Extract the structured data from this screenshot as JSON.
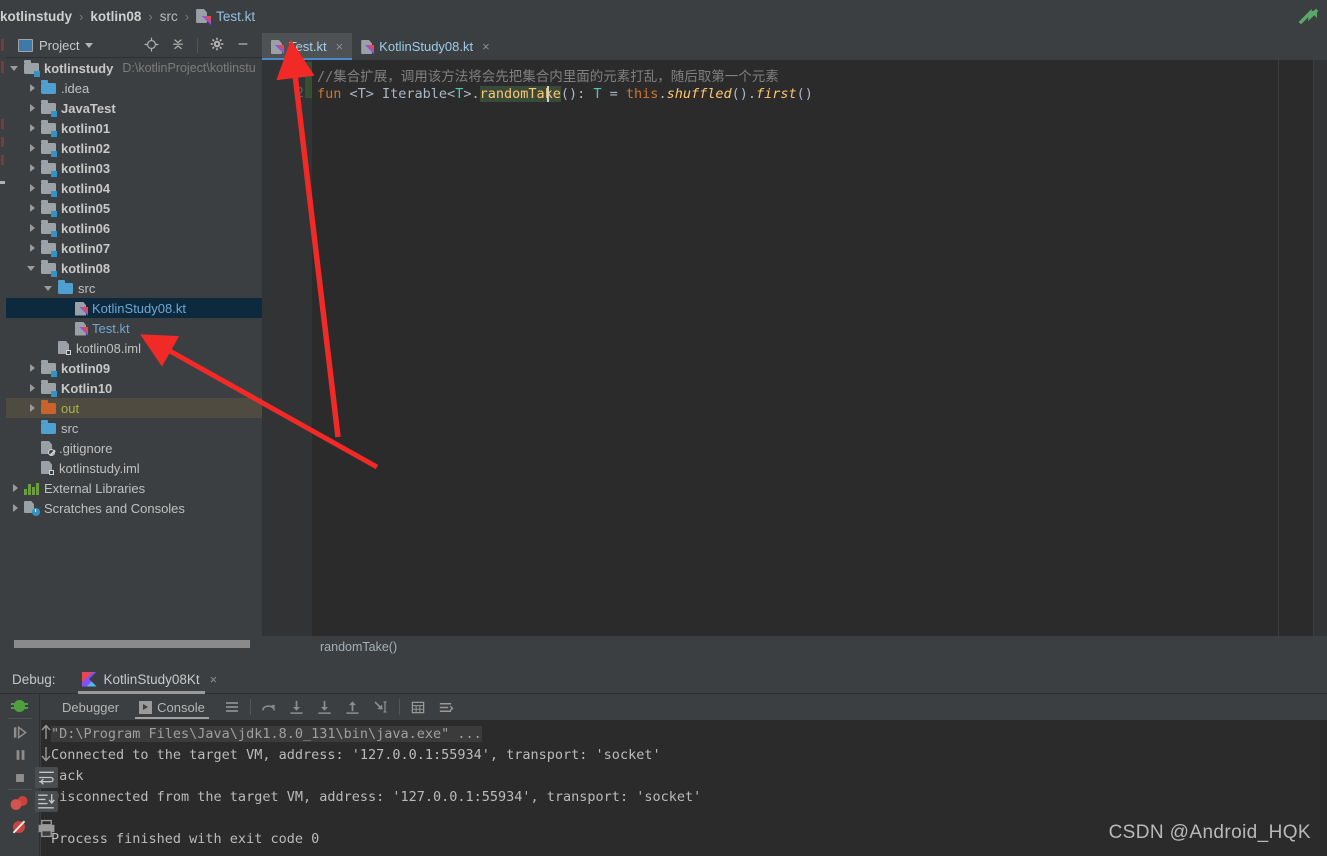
{
  "breadcrumb": {
    "items": [
      "kotlinstudy",
      "kotlin08",
      "src"
    ],
    "file": "Test.kt",
    "separator": "›"
  },
  "project_panel": {
    "title": "Project",
    "icons": [
      "locate-icon",
      "collapse-all-icon",
      "gear-icon",
      "minimize-icon"
    ],
    "tree": [
      {
        "label": "kotlinstudy",
        "path": "D:\\kotlinProject\\kotlinstu",
        "icon": "module-folder-icon",
        "indent": 0,
        "twisty": "down",
        "style": "bold"
      },
      {
        "label": ".idea",
        "icon": "folder-icon",
        "indent": 1,
        "twisty": "right",
        "style": "plain"
      },
      {
        "label": "JavaTest",
        "icon": "module-folder-icon",
        "indent": 1,
        "twisty": "right",
        "style": "bold"
      },
      {
        "label": "kotlin01",
        "icon": "module-folder-icon",
        "indent": 1,
        "twisty": "right",
        "style": "bold"
      },
      {
        "label": "kotlin02",
        "icon": "module-folder-icon",
        "indent": 1,
        "twisty": "right",
        "style": "bold"
      },
      {
        "label": "kotlin03",
        "icon": "module-folder-icon",
        "indent": 1,
        "twisty": "right",
        "style": "bold"
      },
      {
        "label": "kotlin04",
        "icon": "module-folder-icon",
        "indent": 1,
        "twisty": "right",
        "style": "bold"
      },
      {
        "label": "kotlin05",
        "icon": "module-folder-icon",
        "indent": 1,
        "twisty": "right",
        "style": "bold"
      },
      {
        "label": "kotlin06",
        "icon": "module-folder-icon",
        "indent": 1,
        "twisty": "right",
        "style": "bold"
      },
      {
        "label": "kotlin07",
        "icon": "module-folder-icon",
        "indent": 1,
        "twisty": "right",
        "style": "bold"
      },
      {
        "label": "kotlin08",
        "icon": "module-folder-icon",
        "indent": 1,
        "twisty": "down",
        "style": "bold"
      },
      {
        "label": "src",
        "icon": "folder-icon",
        "indent": 2,
        "twisty": "down",
        "style": "plain"
      },
      {
        "label": "KotlinStudy08.kt",
        "icon": "kotlin-file-icon",
        "indent": 3,
        "twisty": "none",
        "style": "blue",
        "selected": true
      },
      {
        "label": "Test.kt",
        "icon": "kotlin-file-icon",
        "indent": 3,
        "twisty": "none",
        "style": "blue"
      },
      {
        "label": "kotlin08.iml",
        "icon": "iml-file-icon",
        "indent": 2,
        "twisty": "none",
        "style": "plain"
      },
      {
        "label": "kotlin09",
        "icon": "module-folder-icon",
        "indent": 1,
        "twisty": "right",
        "style": "bold"
      },
      {
        "label": "Kotlin10",
        "icon": "module-folder-icon",
        "indent": 1,
        "twisty": "right",
        "style": "bold"
      },
      {
        "label": "out",
        "icon": "orange-folder-icon",
        "indent": 1,
        "twisty": "right",
        "style": "olive",
        "highlight": true
      },
      {
        "label": "src",
        "icon": "folder-icon",
        "indent": 1,
        "twisty": "none",
        "style": "plain"
      },
      {
        "label": ".gitignore",
        "icon": "gitignore-file-icon",
        "indent": 1,
        "twisty": "none",
        "style": "plain"
      },
      {
        "label": "kotlinstudy.iml",
        "icon": "iml-file-icon",
        "indent": 1,
        "twisty": "none",
        "style": "plain"
      },
      {
        "label": "External Libraries",
        "icon": "libraries-icon",
        "indent": 0,
        "twisty": "right",
        "style": "plain"
      },
      {
        "label": "Scratches and Consoles",
        "icon": "scratches-icon",
        "indent": 0,
        "twisty": "right",
        "style": "plain"
      }
    ]
  },
  "editor": {
    "tabs": [
      {
        "label": "Test.kt",
        "icon": "kotlin-file-icon",
        "active": true,
        "close": "×"
      },
      {
        "label": "KotlinStudy08.kt",
        "icon": "kotlin-file-icon",
        "active": false,
        "close": "×"
      }
    ],
    "line_numbers": [
      "1",
      "2"
    ],
    "code": {
      "line1_comment": "//集合扩展，调用该方法将会先把集合内里面的元素打乱，随后取第一个元素",
      "t_fun": "fun ",
      "t_generic": "<T> ",
      "t_recv": "Iterable<",
      "t_tparam": "T",
      "t_recv2": ">.",
      "t_fname": "randomTake",
      "t_parens": "(): ",
      "t_ret": "T",
      "t_eq": " = ",
      "t_this": "this",
      "t_dot": ".",
      "t_shuffled": "shuffled",
      "t_call1": "().",
      "t_first": "first",
      "t_call2": "()"
    },
    "breadcrumb_bottom": "randomTake()"
  },
  "debug": {
    "label": "Debug:",
    "run_config": "KotlinStudy08Kt",
    "close": "×",
    "tabs": [
      {
        "label": "Debugger",
        "active": false
      },
      {
        "label": "Console",
        "active": true,
        "icon": "console-play-icon"
      }
    ],
    "side_icons": [
      "bug-icon",
      "resume-program-icon",
      "pause-program-icon",
      "stop-icon",
      "view-breakpoints-icon",
      "mute-breakpoints-icon"
    ],
    "right_icons": [
      "up-arrow-icon",
      "down-arrow-icon",
      "soft-wrap-icon",
      "scroll-to-end-icon",
      "print-icon"
    ],
    "toolbar_icons": [
      "menu-icon",
      "step-out-icon",
      "step-over-icon",
      "step-into-icon",
      "force-step-into-icon",
      "run-to-cursor-icon",
      "evaluate-expression-icon",
      "settings-icon"
    ],
    "console_lines": [
      {
        "text": "\"D:\\Program Files\\Java\\jdk1.8.0_131\\bin\\java.exe\" ...",
        "highlighted": true
      },
      {
        "text": "Connected to the target VM, address: '127.0.0.1:55934', transport: 'socket'",
        "highlighted": false
      },
      {
        "text": "Jack",
        "highlighted": false
      },
      {
        "text": "Disconnected from the target VM, address: '127.0.0.1:55934', transport: 'socket'",
        "highlighted": false
      },
      {
        "text": "",
        "highlighted": false
      },
      {
        "text": "Process finished with exit code 0",
        "highlighted": false
      }
    ]
  },
  "watermark": "CSDN @Android_HQK",
  "annotations": {
    "arrow_color": "#f22a27",
    "arrow1_target": "editor-tab-test-kt",
    "arrow2_target": "tree-item-kotlin08-iml"
  },
  "colors": {
    "background": "#3c3f41",
    "editor_background": "#2b2b2b",
    "selection": "#0d293e",
    "accent_blue": "#4a88c7",
    "annotation_red": "#f22a27"
  }
}
